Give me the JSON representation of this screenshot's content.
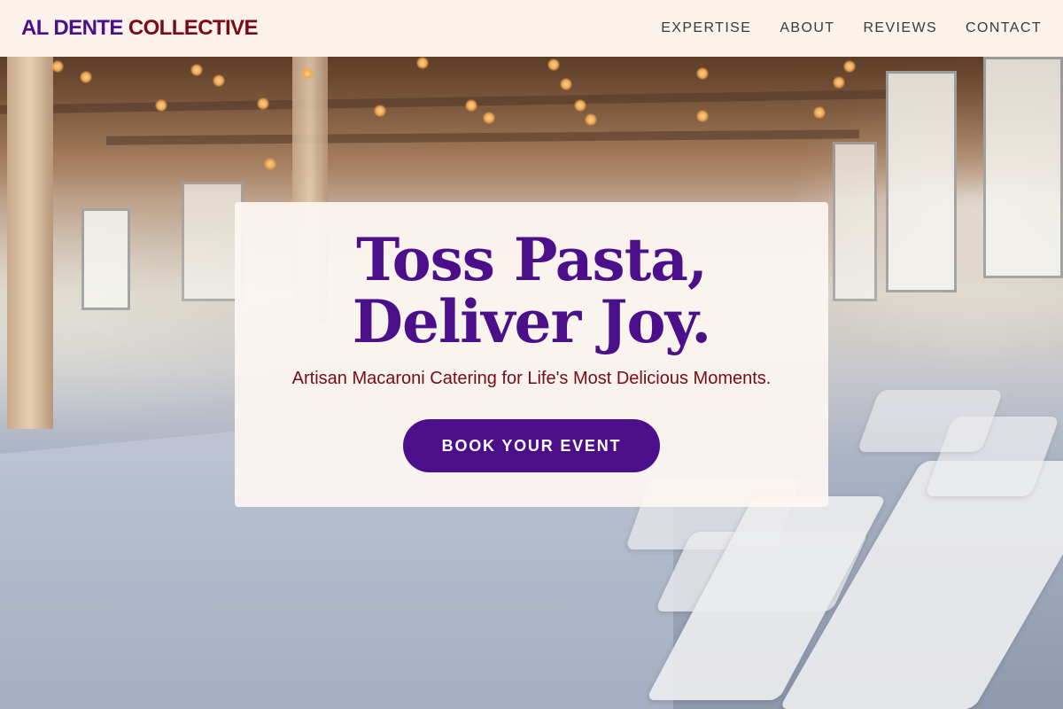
{
  "brand": {
    "name_part1": "AL DENTE",
    "name_part2": "COLLECTIVE",
    "color_primary": "#4b0f8a",
    "color_secondary": "#7a0a14"
  },
  "nav": {
    "items": [
      {
        "label": "EXPERTISE"
      },
      {
        "label": "ABOUT"
      },
      {
        "label": "REVIEWS"
      },
      {
        "label": "CONTACT"
      }
    ]
  },
  "hero": {
    "title_line1": "Toss Pasta,",
    "title_line2": "Deliver Joy.",
    "subtitle": "Artisan Macaroni Catering for Life's Most Delicious Moments.",
    "cta_label": "BOOK YOUR EVENT",
    "background_image": "event-hall-photo"
  }
}
